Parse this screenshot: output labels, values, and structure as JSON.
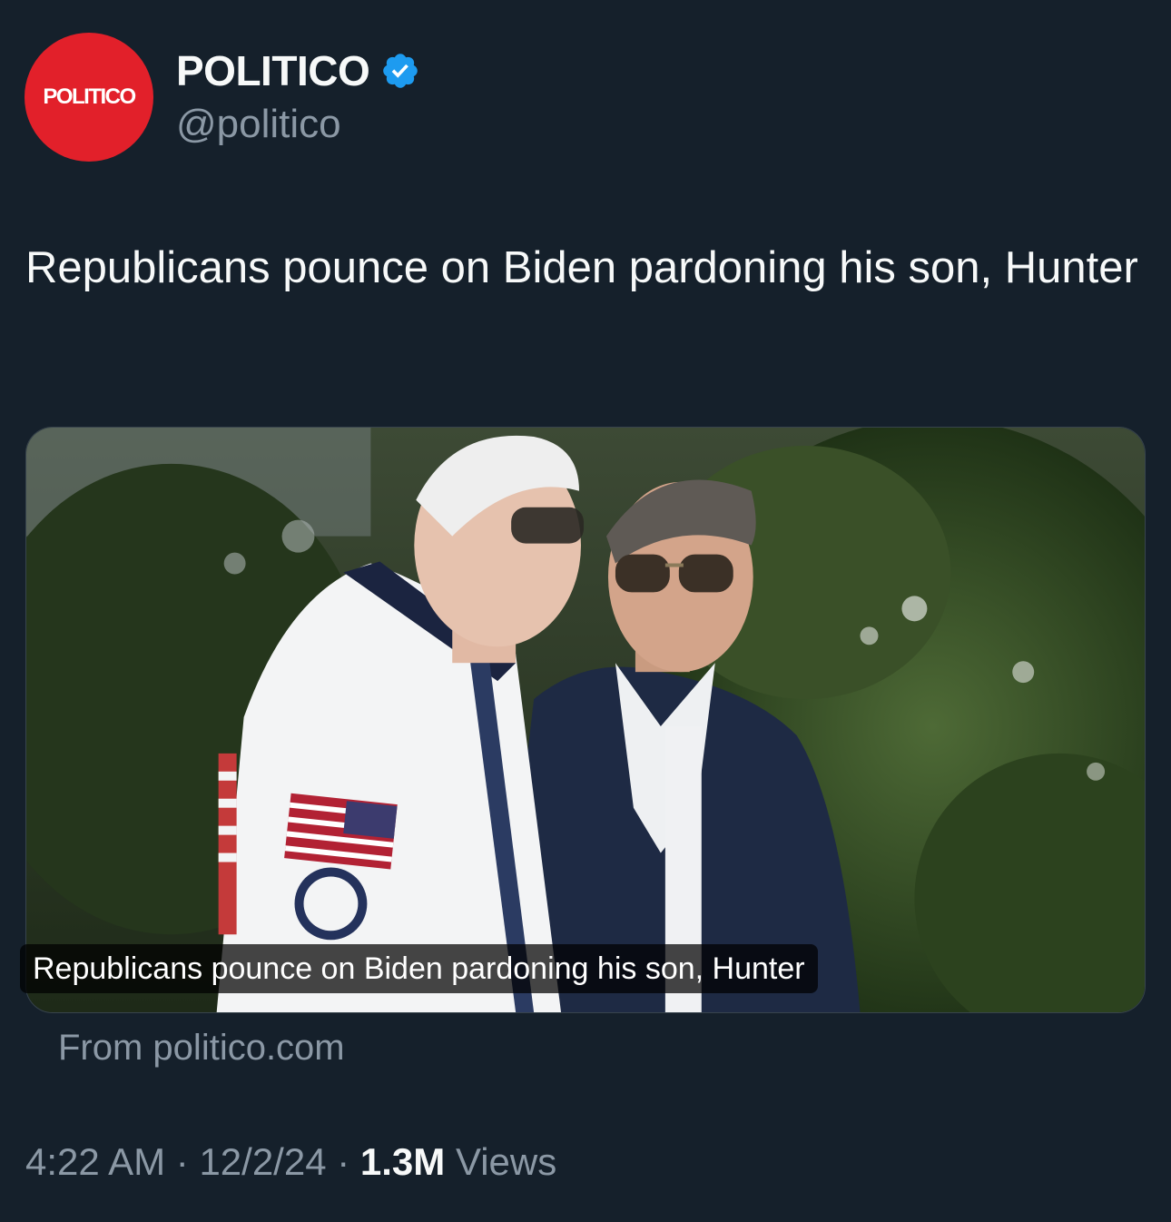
{
  "author": {
    "avatar_text": "POLITICO",
    "display_name": "POLITICO",
    "handle": "@politico",
    "verified_icon": "verified-badge-icon",
    "avatar_color": "#e2202a",
    "verified_color": "#1d9bf0"
  },
  "tweet": {
    "text": "Republicans pounce on Biden pardoning his son, Hunter"
  },
  "card": {
    "image_caption": "Republicans pounce on Biden pardoning his son, Hunter",
    "source": "From politico.com"
  },
  "meta": {
    "time": "4:22 AM",
    "separator1": " · ",
    "date": "12/2/24",
    "separator2": " · ",
    "views_count": "1.3M",
    "views_label": " Views"
  }
}
